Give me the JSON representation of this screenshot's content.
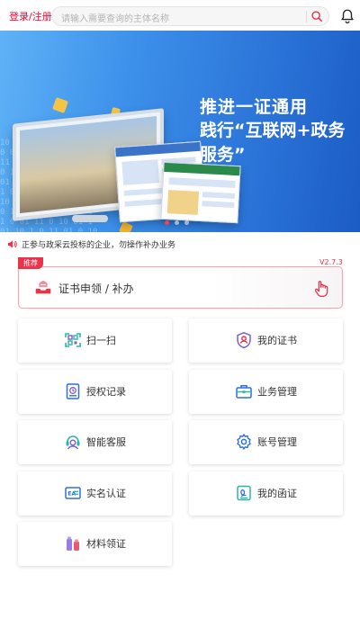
{
  "header": {
    "login_label": "登录/注册",
    "search_placeholder": "请输入需要查询的主体名称"
  },
  "banner": {
    "headline_1": "推进一证通用",
    "headline_2": "践行“互联网+政务服务”",
    "slide_count": 3,
    "active_slide": 1
  },
  "notice": {
    "text": "正参与政采云投标的企业，勿操作补办业务"
  },
  "cert_panel": {
    "badge": "推荐",
    "version": "V2.7.3",
    "label": "证书申领 / 补办"
  },
  "menu": [
    {
      "label": "扫一扫",
      "icon": "scan-icon"
    },
    {
      "label": "我的证书",
      "icon": "certificate-shield-icon"
    },
    {
      "label": "授权记录",
      "icon": "authorization-record-icon"
    },
    {
      "label": "业务管理",
      "icon": "briefcase-icon"
    },
    {
      "label": "智能客服",
      "icon": "customer-service-icon"
    },
    {
      "label": "账号管理",
      "icon": "gear-icon"
    },
    {
      "label": "实名认证",
      "icon": "id-card-icon"
    },
    {
      "label": "我的函证",
      "icon": "letter-icon"
    },
    {
      "label": "材料领证",
      "icon": "materials-icon"
    }
  ],
  "colors": {
    "brand_red": "#e8334a",
    "banner_blue": "#2b74d8",
    "icon_teal": "#2bb5a8",
    "icon_purple": "#7b5cd6",
    "icon_blue": "#2f6fd8"
  }
}
